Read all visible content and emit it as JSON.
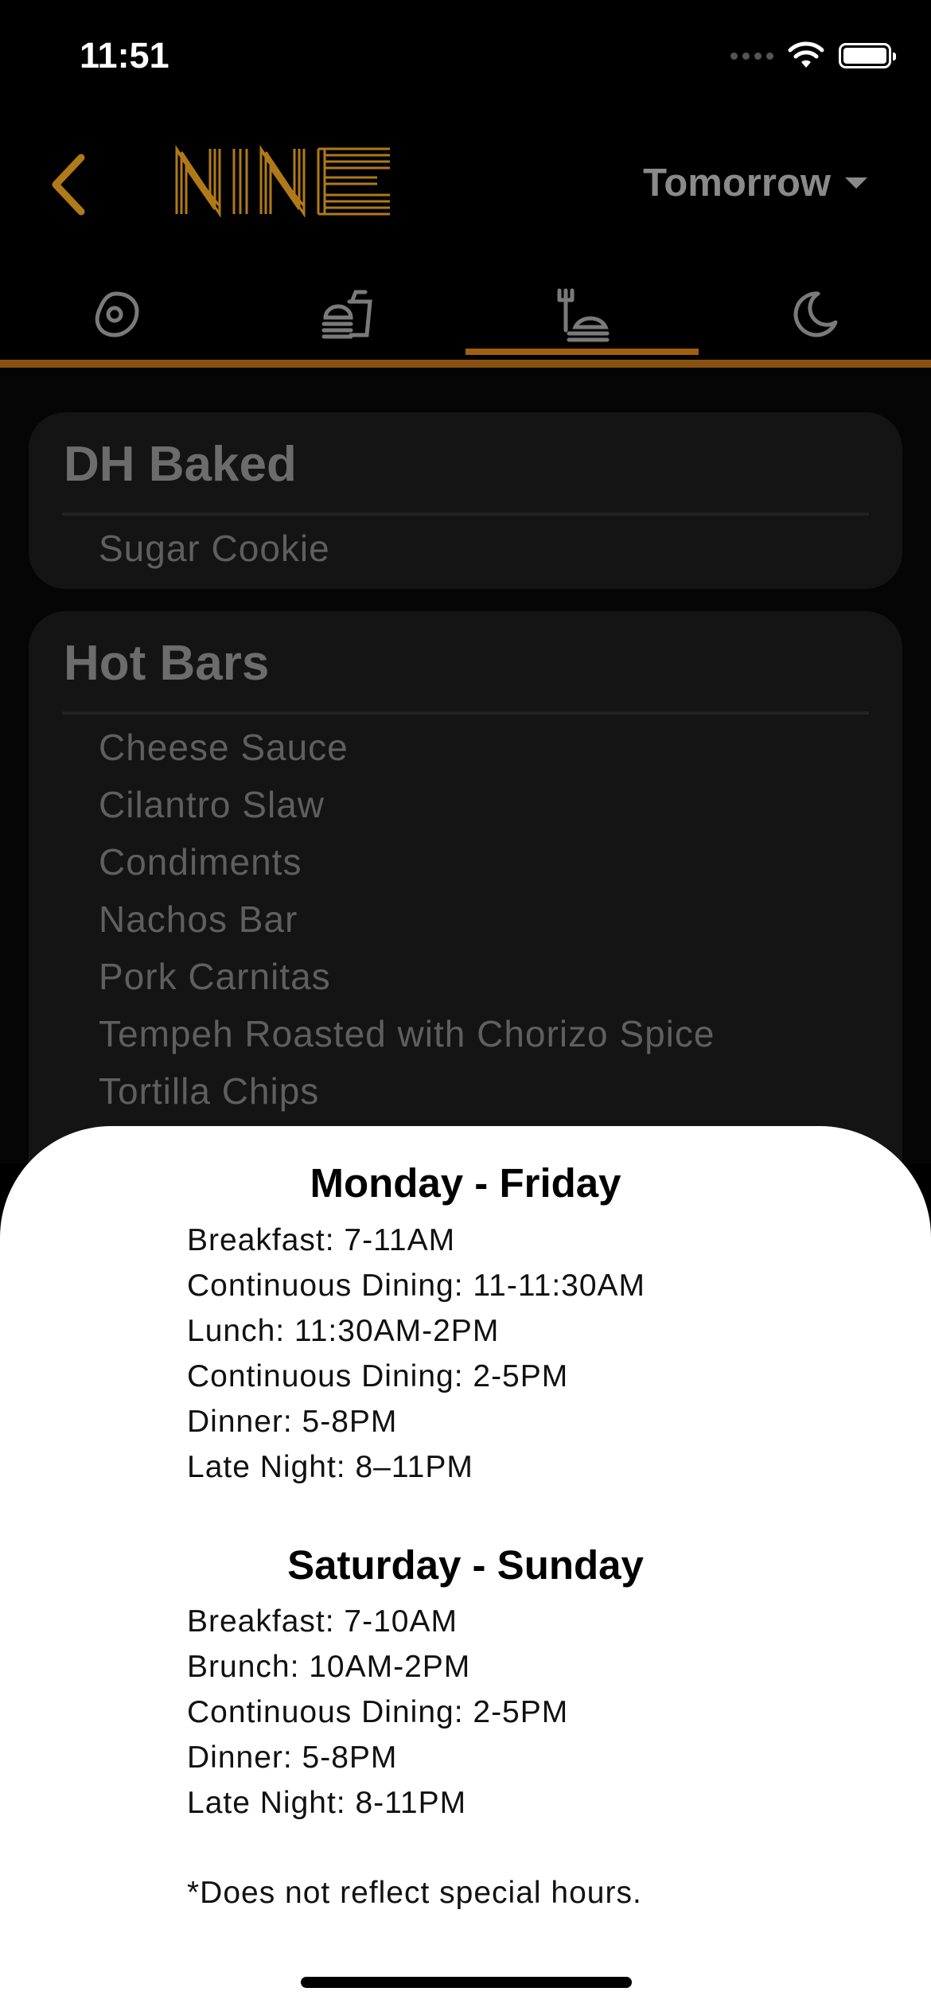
{
  "status_bar": {
    "time": "11:51"
  },
  "header": {
    "logo_text": "NINE",
    "day_selector": "Tomorrow",
    "accent_color": "#b07a18"
  },
  "tabs": [
    {
      "icon": "breakfast-egg-icon",
      "active": false
    },
    {
      "icon": "lunch-tray-icon",
      "active": false
    },
    {
      "icon": "dinner-plate-icon",
      "active": true
    },
    {
      "icon": "late-night-moon-icon",
      "active": false
    }
  ],
  "menu": {
    "sections": [
      {
        "title": "DH Baked",
        "items": [
          "Sugar Cookie"
        ]
      },
      {
        "title": "Hot Bars",
        "items": [
          "Cheese Sauce",
          "Cilantro Slaw",
          "Condiments",
          "Nachos Bar",
          "Pork Carnitas",
          "Tempeh Roasted with Chorizo Spice",
          "Tortilla Chips"
        ]
      }
    ]
  },
  "hours_sheet": {
    "weekday": {
      "heading": "Monday - Friday",
      "lines": [
        "Breakfast: 7-11AM",
        "Continuous Dining: 11-11:30AM",
        "Lunch: 11:30AM-2PM",
        "Continuous Dining: 2-5PM",
        "Dinner: 5-8PM",
        "Late Night: 8–11PM"
      ]
    },
    "weekend": {
      "heading": "Saturday - Sunday",
      "lines": [
        "Breakfast: 7-10AM",
        "Brunch: 10AM-2PM",
        "Continuous Dining: 2-5PM",
        "Dinner: 5-8PM",
        "Late Night: 8-11PM"
      ]
    },
    "footnote": "*Does not reflect special hours."
  }
}
